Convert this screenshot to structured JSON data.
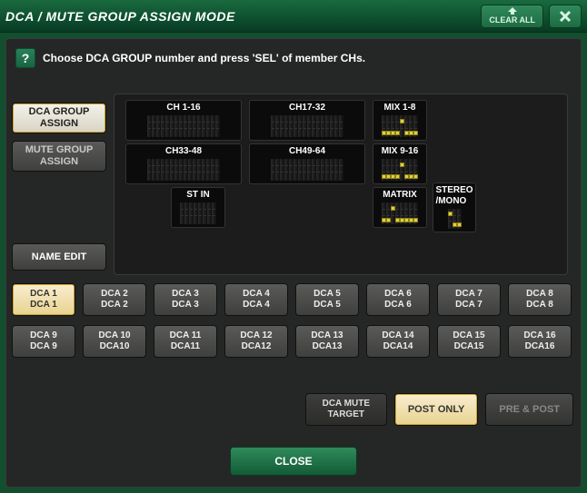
{
  "title": "DCA / MUTE GROUP ASSIGN MODE",
  "controls": {
    "clear": "CLEAR ALL",
    "close_x": "✕"
  },
  "instruction": "Choose DCA GROUP number and press 'SEL' of member CHs.",
  "mode": {
    "dca": "DCA GROUP\nASSIGN",
    "mute": "MUTE GROUP\nASSIGN"
  },
  "groups": {
    "ch1_16": "CH 1-16",
    "ch17_32": "CH17-32",
    "mix1_8": "MIX 1-8",
    "ch33_48": "CH33-48",
    "ch49_64": "CH49-64",
    "mix9_16": "MIX 9-16",
    "stin": "ST IN",
    "matrix": "MATRIX",
    "stmono": "STEREO\n/MONO"
  },
  "nameEdit": "NAME EDIT",
  "dca_buttons": [
    {
      "top": "DCA 1",
      "bottom": "DCA 1",
      "selected": true
    },
    {
      "top": "DCA 2",
      "bottom": "DCA 2",
      "selected": false
    },
    {
      "top": "DCA 3",
      "bottom": "DCA 3",
      "selected": false
    },
    {
      "top": "DCA 4",
      "bottom": "DCA 4",
      "selected": false
    },
    {
      "top": "DCA 5",
      "bottom": "DCA 5",
      "selected": false
    },
    {
      "top": "DCA 6",
      "bottom": "DCA 6",
      "selected": false
    },
    {
      "top": "DCA 7",
      "bottom": "DCA 7",
      "selected": false
    },
    {
      "top": "DCA 8",
      "bottom": "DCA 8",
      "selected": false
    },
    {
      "top": "DCA 9",
      "bottom": "DCA 9",
      "selected": false
    },
    {
      "top": "DCA 10",
      "bottom": "DCA10",
      "selected": false
    },
    {
      "top": "DCA 11",
      "bottom": "DCA11",
      "selected": false
    },
    {
      "top": "DCA 12",
      "bottom": "DCA12",
      "selected": false
    },
    {
      "top": "DCA 13",
      "bottom": "DCA13",
      "selected": false
    },
    {
      "top": "DCA 14",
      "bottom": "DCA14",
      "selected": false
    },
    {
      "top": "DCA 15",
      "bottom": "DCA15",
      "selected": false
    },
    {
      "top": "DCA 16",
      "bottom": "DCA16",
      "selected": false
    }
  ],
  "muteTarget": {
    "label": "DCA MUTE\nTARGET",
    "post": "POST ONLY",
    "prepost": "PRE & POST"
  },
  "closeLabel": "CLOSE"
}
